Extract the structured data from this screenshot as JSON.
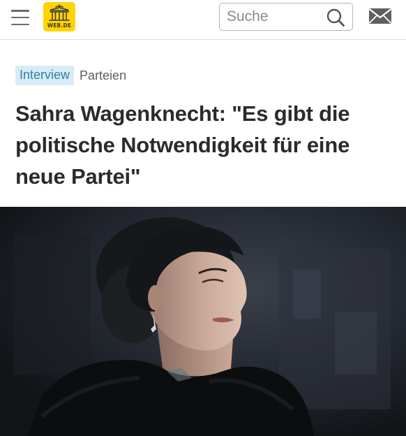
{
  "header": {
    "logo_text": "WEB.DE",
    "search_placeholder": "Suche",
    "brand_color": "#ffd400",
    "icons": [
      "menu-icon",
      "search-icon",
      "mail-icon"
    ]
  },
  "article": {
    "category": "Interview",
    "section": "Parteien",
    "title": "Sahra Wagenknecht: \"Es gibt die politische Notwendigkeit für eine neue Partei\"",
    "category_color": "#2e7fa6"
  },
  "image": {
    "subject": "portrait-photo"
  }
}
